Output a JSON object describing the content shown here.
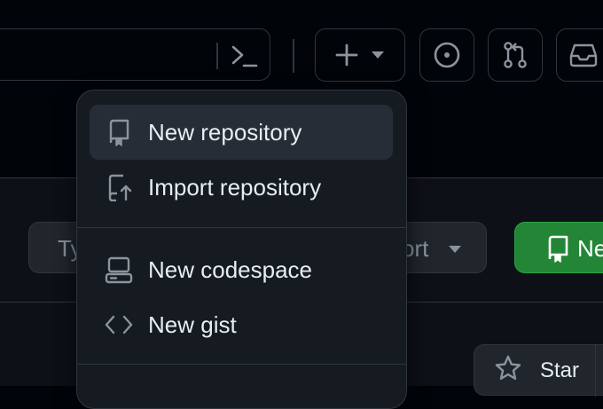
{
  "header": {
    "command_palette_icon": "terminal-icon",
    "create_button_icons": [
      "plus-icon",
      "triangle-down-icon"
    ],
    "issues_icon": "issue-opened-icon",
    "pull_requests_icon": "git-pull-request-icon",
    "inbox_icon": "inbox-icon"
  },
  "toolbar": {
    "type_filter_label": "Ty",
    "sort_label": "ort",
    "new_button_label": "Ne",
    "new_button_icon": "repo-icon"
  },
  "repo_row": {
    "star_label": "Star",
    "star_icon": "star-icon"
  },
  "create_menu": {
    "items": [
      {
        "label": "New repository",
        "icon": "repo-icon"
      },
      {
        "label": "Import repository",
        "icon": "repo-push-icon"
      },
      {
        "label": "New codespace",
        "icon": "codespaces-icon"
      },
      {
        "label": "New gist",
        "icon": "code-icon"
      }
    ]
  },
  "colors": {
    "background": "#010409",
    "surface": "#0d1117",
    "menu": "#161b22",
    "border": "#30363d",
    "accent_green": "#238636",
    "text": "#e6edf3",
    "muted": "#8b949e"
  }
}
